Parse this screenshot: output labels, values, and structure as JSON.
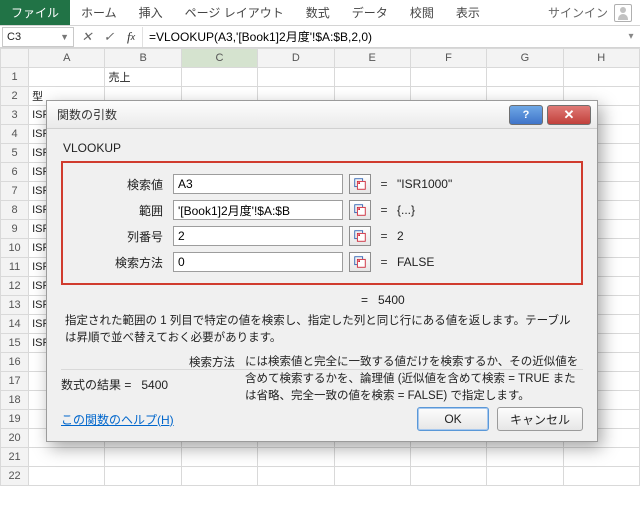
{
  "ribbon": {
    "file": "ファイル",
    "tabs": [
      "ホーム",
      "挿入",
      "ページ レイアウト",
      "数式",
      "データ",
      "校閲",
      "表示"
    ],
    "signin": "サインイン"
  },
  "namebox": "C3",
  "formula": "=VLOOKUP(A3,'[Book1]2月度'!$A:$B,2,0)",
  "columns": [
    "A",
    "B",
    "C",
    "D",
    "E",
    "F",
    "G",
    "H"
  ],
  "b1": "売上",
  "a2": "型",
  "colA_prefix": "ISR",
  "dialog": {
    "title": "関数の引数",
    "func": "VLOOKUP",
    "rows": [
      {
        "label": "検索値",
        "value": "A3",
        "result": "\"ISR1000\""
      },
      {
        "label": "範囲",
        "value": "'[Book1]2月度'!$A:$B",
        "result": "{...}"
      },
      {
        "label": "列番号",
        "value": "2",
        "result": "2"
      },
      {
        "label": "検索方法",
        "value": "0",
        "result": "FALSE"
      }
    ],
    "overall_eq": "=",
    "overall_result": "5400",
    "description": "指定された範囲の 1 列目で特定の値を検索し、指定した列と同じ行にある値を返します。テーブルは昇順で並べ替えておく必要があります。",
    "arg_desc_label": "検索方法",
    "arg_desc_text": "には検索値と完全に一致する値だけを検索するか、その近似値を含めて検索するかを、論理値 (近似値を含めて検索 = TRUE または省略、完全一致の値を検索 = FALSE) で指定します。",
    "formula_result_label": "数式の結果 =",
    "formula_result_value": "5400",
    "help_link": "この関数のヘルプ(H)",
    "ok": "OK",
    "cancel": "キャンセル"
  }
}
